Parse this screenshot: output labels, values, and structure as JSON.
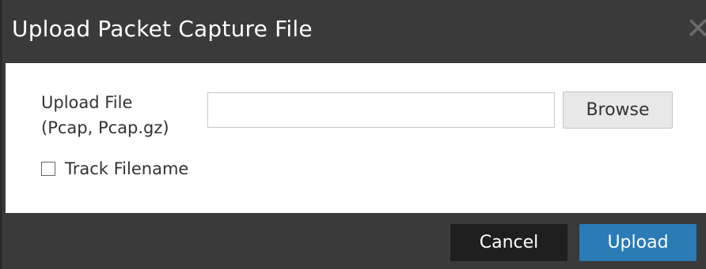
{
  "dialog": {
    "title": "Upload Packet Capture File",
    "close_glyph": "✕"
  },
  "form": {
    "upload_label_line1": "Upload File",
    "upload_label_line2": "(Pcap, Pcap.gz)",
    "file_value": "",
    "browse_label": "Browse",
    "track_filename_label": "Track Filename",
    "track_filename_checked": false
  },
  "footer": {
    "cancel_label": "Cancel",
    "upload_label": "Upload"
  },
  "colors": {
    "chrome": "#3a3a3a",
    "primary": "#2a7bb6",
    "secondary": "#1f1f1f"
  }
}
